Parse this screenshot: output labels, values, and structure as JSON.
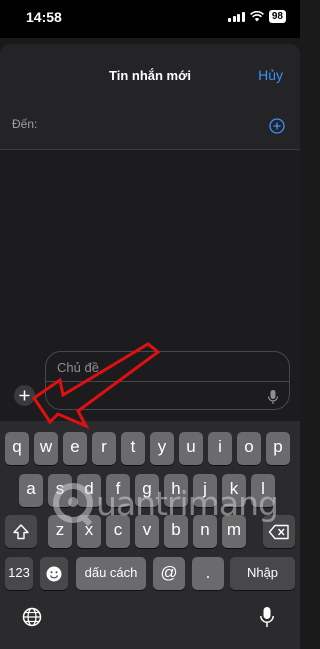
{
  "status_bar": {
    "time": "14:58",
    "battery": "98"
  },
  "header": {
    "title": "Tin nhắn mới",
    "cancel_label": "Hủy"
  },
  "recipient": {
    "label": "Đến:"
  },
  "compose": {
    "subject_placeholder": "Chủ đề"
  },
  "keyboard": {
    "row1": [
      "q",
      "w",
      "e",
      "r",
      "t",
      "y",
      "u",
      "i",
      "o",
      "p"
    ],
    "row2": [
      "a",
      "s",
      "d",
      "f",
      "g",
      "h",
      "j",
      "k",
      "l"
    ],
    "row3": [
      "z",
      "x",
      "c",
      "v",
      "b",
      "n",
      "m"
    ],
    "numbers_key": "123",
    "space_key": "dấu cách",
    "at_key": "@",
    "period_key": ".",
    "return_key": "Nhập"
  },
  "watermark": {
    "text": "uantrimang"
  },
  "colors": {
    "accent": "#3a8fff",
    "annotation_arrow": "#e01010"
  }
}
